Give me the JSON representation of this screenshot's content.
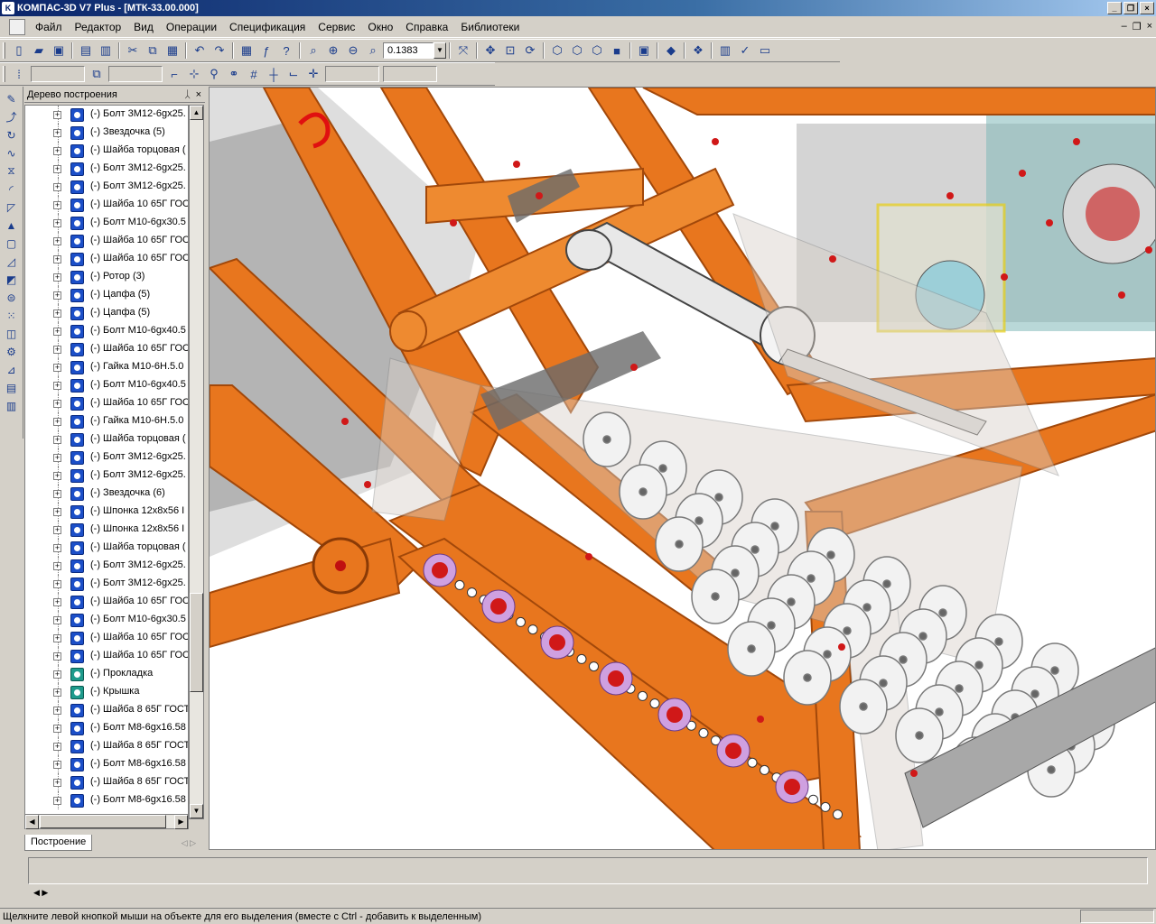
{
  "window": {
    "title": "КОМПАС-3D V7 Plus - [МТК-33.00.000]",
    "min_label": "_",
    "restore_label": "❐",
    "close_label": "×"
  },
  "menu": {
    "items": [
      "Файл",
      "Редактор",
      "Вид",
      "Операции",
      "Спецификация",
      "Сервис",
      "Окно",
      "Справка",
      "Библиотеки"
    ],
    "mdi_min": "–",
    "mdi_restore": "❐",
    "mdi_close": "×"
  },
  "toolbar": {
    "zoom_value": "0.1383"
  },
  "tree": {
    "title": "Дерево построения",
    "pin_label": "ᛸ",
    "close_label": "×",
    "tab_label": "Построение",
    "items": [
      {
        "label": "(-) Болт 3М12-6gх25.",
        "icon": "part"
      },
      {
        "label": "(-) Звездочка (5)",
        "icon": "part"
      },
      {
        "label": "(-) Шайба торцовая (",
        "icon": "part"
      },
      {
        "label": "(-) Болт 3М12-6gх25.",
        "icon": "part"
      },
      {
        "label": "(-) Болт 3М12-6gх25.",
        "icon": "part"
      },
      {
        "label": "(-) Шайба 10 65Г ГОС",
        "icon": "part"
      },
      {
        "label": "(-) Болт М10-6gх30.5",
        "icon": "part"
      },
      {
        "label": "(-) Шайба 10 65Г ГОС",
        "icon": "part"
      },
      {
        "label": "(-) Шайба 10 65Г ГОС",
        "icon": "part"
      },
      {
        "label": "(-) Ротор (3)",
        "icon": "part"
      },
      {
        "label": "(-) Цапфа (5)",
        "icon": "part"
      },
      {
        "label": "(-) Цапфа (5)",
        "icon": "part"
      },
      {
        "label": "(-) Болт М10-6gх40.5",
        "icon": "part"
      },
      {
        "label": "(-) Шайба 10 65Г ГОС",
        "icon": "part"
      },
      {
        "label": "(-) Гайка М10-6Н.5.0",
        "icon": "part"
      },
      {
        "label": "(-) Болт М10-6gх40.5",
        "icon": "part"
      },
      {
        "label": "(-) Шайба 10 65Г ГОС",
        "icon": "part"
      },
      {
        "label": "(-) Гайка М10-6Н.5.0",
        "icon": "part"
      },
      {
        "label": "(-) Шайба торцовая (",
        "icon": "part"
      },
      {
        "label": "(-) Болт 3М12-6gх25.",
        "icon": "part"
      },
      {
        "label": "(-) Болт 3М12-6gх25.",
        "icon": "part"
      },
      {
        "label": "(-) Звездочка (6)",
        "icon": "part"
      },
      {
        "label": "(-) Шпонка 12х8х56 I",
        "icon": "part"
      },
      {
        "label": "(-) Шпонка 12х8х56 I",
        "icon": "part"
      },
      {
        "label": "(-) Шайба торцовая (",
        "icon": "part"
      },
      {
        "label": "(-) Болт 3М12-6gх25.",
        "icon": "part"
      },
      {
        "label": "(-) Болт 3М12-6gх25.",
        "icon": "part"
      },
      {
        "label": "(-) Шайба 10 65Г ГОС",
        "icon": "part"
      },
      {
        "label": "(-) Болт М10-6gх30.5",
        "icon": "part"
      },
      {
        "label": "(-) Шайба 10 65Г ГОС",
        "icon": "part"
      },
      {
        "label": "(-) Шайба 10 65Г ГОС",
        "icon": "part"
      },
      {
        "label": "(-) Прокладка",
        "icon": "green"
      },
      {
        "label": "(-) Крышка",
        "icon": "green"
      },
      {
        "label": "(-) Шайба 8 65Г ГОСТ",
        "icon": "part"
      },
      {
        "label": "(-) Болт М8-6gх16.58",
        "icon": "part"
      },
      {
        "label": "(-) Шайба 8 65Г ГОСТ",
        "icon": "part"
      },
      {
        "label": "(-) Болт М8-6gх16.58",
        "icon": "part"
      },
      {
        "label": "(-) Шайба 8 65Г ГОСТ",
        "icon": "part"
      },
      {
        "label": "(-) Болт М8-6gх16.58",
        "icon": "part"
      }
    ]
  },
  "status": {
    "hint": "Щелкните левой кнопкой мыши на объекте для его выделения (вместе с Ctrl - добавить к выделенным)"
  },
  "colors": {
    "frame_orange": "#e8761e",
    "frame_dark": "#b4540e",
    "steel_gray": "#9a9a9a",
    "roller_white": "#f2f2f2",
    "bolt_red": "#d01818",
    "titlebar": "#0a246a"
  }
}
